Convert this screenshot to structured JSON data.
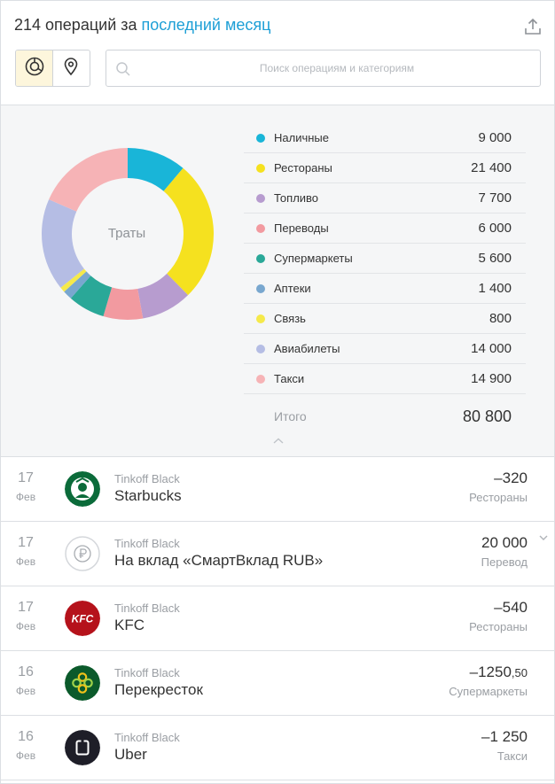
{
  "header": {
    "title_prefix": "214 операций за ",
    "title_link": "последний месяц",
    "export_icon": "upload-icon"
  },
  "view_toggle": {
    "items": [
      {
        "icon": "donut-chart-icon",
        "active": true
      },
      {
        "icon": "map-pin-icon",
        "active": false
      }
    ]
  },
  "search": {
    "placeholder": "Поиск операциям и категориям",
    "value": ""
  },
  "chart": {
    "center_label": "Траты"
  },
  "chart_data": {
    "type": "pie",
    "categories": [
      "Наличные",
      "Рестораны",
      "Топливо",
      "Переводы",
      "Супермаркеты",
      "Аптеки",
      "Связь",
      "Авиабилеты",
      "Такси"
    ],
    "values": [
      9000,
      21400,
      7700,
      6000,
      5600,
      1400,
      800,
      14000,
      14900
    ],
    "colors": [
      "#19b5d8",
      "#f5e11f",
      "#b79ccf",
      "#f29aa0",
      "#2aa898",
      "#79a7cf",
      "#f5e94a",
      "#b5bde4",
      "#f6b3b6"
    ],
    "display_values": [
      "9 000",
      "21 400",
      "7 700",
      "6 000",
      "5 600",
      "1 400",
      "800",
      "14 000",
      "14 900"
    ],
    "total_label": "Итого",
    "total": "80 800"
  },
  "transactions": [
    {
      "day": "17",
      "month": "Фев",
      "card": "Tinkoff Black",
      "name": "Starbucks",
      "amount": "–320",
      "amount_cents": "",
      "category": "Рестораны",
      "logo": "starbucks-logo"
    },
    {
      "day": "17",
      "month": "Фев",
      "card": "Tinkoff Black",
      "name": "На вклад «СмартВклад RUB»",
      "amount": "20 000",
      "amount_cents": "",
      "category": "Перевод",
      "logo": "ruble-coin-icon"
    },
    {
      "day": "17",
      "month": "Фев",
      "card": "Tinkoff Black",
      "name": "KFC",
      "amount": "–540",
      "amount_cents": "",
      "category": "Рестораны",
      "logo": "kfc-logo"
    },
    {
      "day": "16",
      "month": "Фев",
      "card": "Tinkoff Black",
      "name": "Перекресток",
      "amount": "–1250",
      "amount_cents": ",50",
      "category": "Супермаркеты",
      "logo": "perekrestok-logo"
    },
    {
      "day": "16",
      "month": "Фев",
      "card": "Tinkoff Black",
      "name": "Uber",
      "amount": "–1 250",
      "amount_cents": "",
      "category": "Такси",
      "logo": "uber-logo"
    }
  ]
}
